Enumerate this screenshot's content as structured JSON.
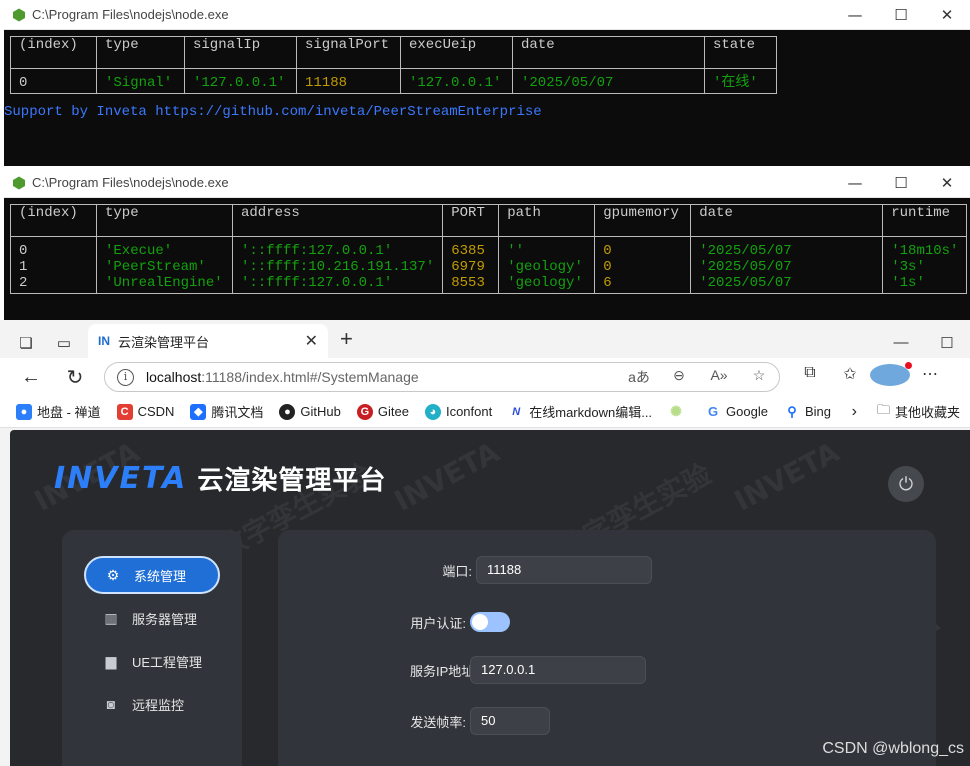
{
  "console1": {
    "title": "C:\\Program Files\\nodejs\\node.exe",
    "columns": [
      "(index)",
      "type",
      "signalIp",
      "signalPort",
      "execUeip",
      "date",
      "state"
    ],
    "row": {
      "index": "0",
      "type": "'Signal'",
      "signalIp": "'127.0.0.1'",
      "signalPort": "11188",
      "execUeip": "'127.0.0.1'",
      "date": "'2025/05/07",
      "state": "'在线'"
    },
    "support": "Support by Inveta https://github.com/inveta/PeerStreamEnterprise"
  },
  "console2": {
    "title": "C:\\Program Files\\nodejs\\node.exe",
    "columns": [
      "(index)",
      "type",
      "address",
      "PORT",
      "path",
      "gpumemory",
      "date",
      "runtime"
    ],
    "rows": {
      "index": "0\n1\n2",
      "type": "'Execue'\n'PeerStream'\n'UnrealEngine'",
      "address": "'::ffff:127.0.0.1'\n'::ffff:10.216.191.137'\n'::ffff:127.0.0.1'",
      "port": "6385\n6979\n8553",
      "path": "''\n'geology'\n'geology'",
      "gpumemory": "0\n0\n6",
      "date": "'2025/05/07\n'2025/05/07\n'2025/05/07",
      "runtime": "'18m10s'\n'3s'\n'1s'"
    }
  },
  "window_controls": {
    "minimize": "—",
    "maximize": "☐",
    "close": "✕"
  },
  "browser": {
    "tab_favicon": "IN",
    "tab_title": "云渲染管理平台",
    "tab_close": "✕",
    "new_tab": "+",
    "url_host": "localhost",
    "url_path": ":11188/index.html#/SystemManage",
    "bookmarks": [
      "地盘 - 禅道",
      "CSDN",
      "腾讯文档",
      "GitHub",
      "Gitee",
      "Iconfont",
      "在线markdown编辑...",
      "Google",
      "Bing"
    ],
    "other_bookmarks": "其他收藏夹"
  },
  "app": {
    "brand": "INVETA",
    "title": "云渲染管理平台",
    "watermark_brand": "INVETA",
    "watermark_text": "数字孪生实验",
    "nav": [
      {
        "label": "系统管理",
        "icon": "gear-icon",
        "active": true
      },
      {
        "label": "服务器管理",
        "icon": "server-icon",
        "active": false
      },
      {
        "label": "UE工程管理",
        "icon": "folder-icon",
        "active": false
      },
      {
        "label": "远程监控",
        "icon": "monitor-icon",
        "active": false
      }
    ],
    "form": {
      "port_label": "端口:",
      "port_value": "11188",
      "auth_label": "用户认证:",
      "auth_enabled": true,
      "ip_label": "服务IP地址",
      "ip_value": "127.0.0.1",
      "rate_label": "发送帧率:",
      "rate_value": "50"
    },
    "accent_color": "#1f6fd6"
  },
  "csdn_watermark": "CSDN @wblong_cs"
}
